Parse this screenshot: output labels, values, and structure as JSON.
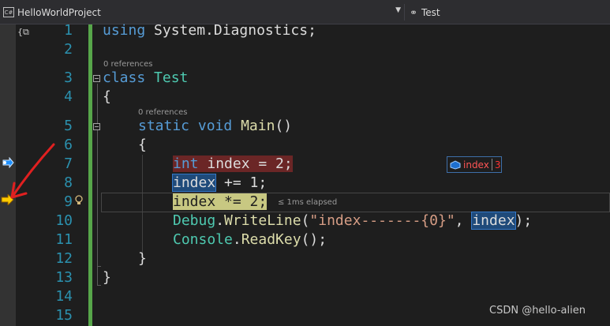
{
  "nav": {
    "project_label": "HelloWorldProject",
    "class_label": "Test"
  },
  "line_numbers": [
    "1",
    "2",
    "3",
    "4",
    "5",
    "6",
    "7",
    "8",
    "9",
    "10",
    "11",
    "12",
    "13",
    "14",
    "15"
  ],
  "codelens": {
    "class_refs": "0 references",
    "method_refs": "0 references"
  },
  "code": {
    "l1_using": "using",
    "l1_ns": " System.Diagnostics;",
    "l3_class": "class",
    "l3_name": "Test",
    "l4_brace": "{",
    "l5_static": "static",
    "l5_void": "void",
    "l5_main": "Main",
    "l5_parens": "()",
    "l6_brace": "{",
    "l7_int": "int",
    "l7_rest": " index = 2;",
    "l8_index": "index",
    "l8_rest": " += 1;",
    "l9_index": "index",
    "l9_rest": " *= 2;",
    "l10_debug": "Debug",
    "l10_dot": ".",
    "l10_writeline": "WriteLine",
    "l10_open": "(",
    "l10_str": "\"index-------{0}\"",
    "l10_comma": ", ",
    "l10_index": "index",
    "l10_close": ");",
    "l11_console": "Console",
    "l11_dot": ".",
    "l11_readkey": "ReadKey",
    "l11_rest": "();",
    "l12_brace": "}",
    "l13_brace": "}"
  },
  "perf_tip": "≤ 1ms elapsed",
  "datatip": {
    "name": "index",
    "value": "3"
  },
  "watermark": "CSDN @hello-alien",
  "colors": {
    "keyword": "#569cd6",
    "type": "#4ec9b0",
    "method": "#dcdcaa",
    "string": "#d69d85",
    "line_number": "#2b91af",
    "change_bar": "#57a64a",
    "breakpoint_highlight": "#6b2626",
    "current_statement_highlight": "#c8c882",
    "annotation_arrow": "#e02020"
  },
  "icons": {
    "project": "csharp-project-icon",
    "class": "class-icon",
    "breakpoint_step": "step-marker-icon",
    "instruction_pointer": "execution-arrow-icon",
    "quick_action": "lightbulb-icon",
    "datatip_field": "field-icon"
  }
}
